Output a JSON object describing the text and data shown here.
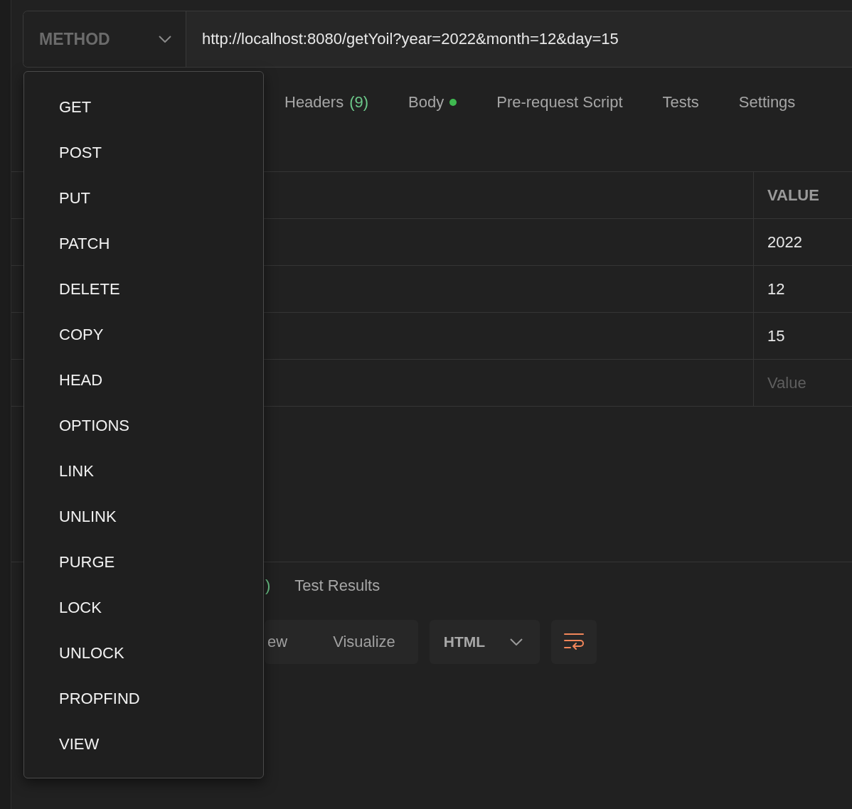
{
  "request": {
    "method": "METHOD",
    "url": "http://localhost:8080/getYoil?year=2022&month=12&day=15"
  },
  "request_tabs": [
    {
      "label": "Headers",
      "count": "(9)",
      "selected": false
    },
    {
      "label": "Body",
      "dot": true,
      "selected": false
    },
    {
      "label": "Pre-request Script",
      "selected": false
    },
    {
      "label": "Tests",
      "selected": false
    },
    {
      "label": "Settings",
      "selected": false
    }
  ],
  "params_table": {
    "columns": [
      "VALUE"
    ],
    "rows": [
      {
        "value": "2022"
      },
      {
        "value": "12"
      },
      {
        "value": "15"
      },
      {
        "placeholder": "Value"
      }
    ]
  },
  "response_tabs": [
    {
      "count": ")",
      "selected": false
    },
    {
      "label": "Test Results",
      "selected": false
    }
  ],
  "view_modes": [
    {
      "label": "ew",
      "selected": false
    },
    {
      "label": "Visualize",
      "selected": false
    }
  ],
  "format_select": {
    "value": "HTML"
  },
  "method_menu": {
    "items": [
      "GET",
      "POST",
      "PUT",
      "PATCH",
      "DELETE",
      "COPY",
      "HEAD",
      "OPTIONS",
      "LINK",
      "UNLINK",
      "PURGE",
      "LOCK",
      "UNLOCK",
      "PROPFIND",
      "VIEW"
    ]
  }
}
